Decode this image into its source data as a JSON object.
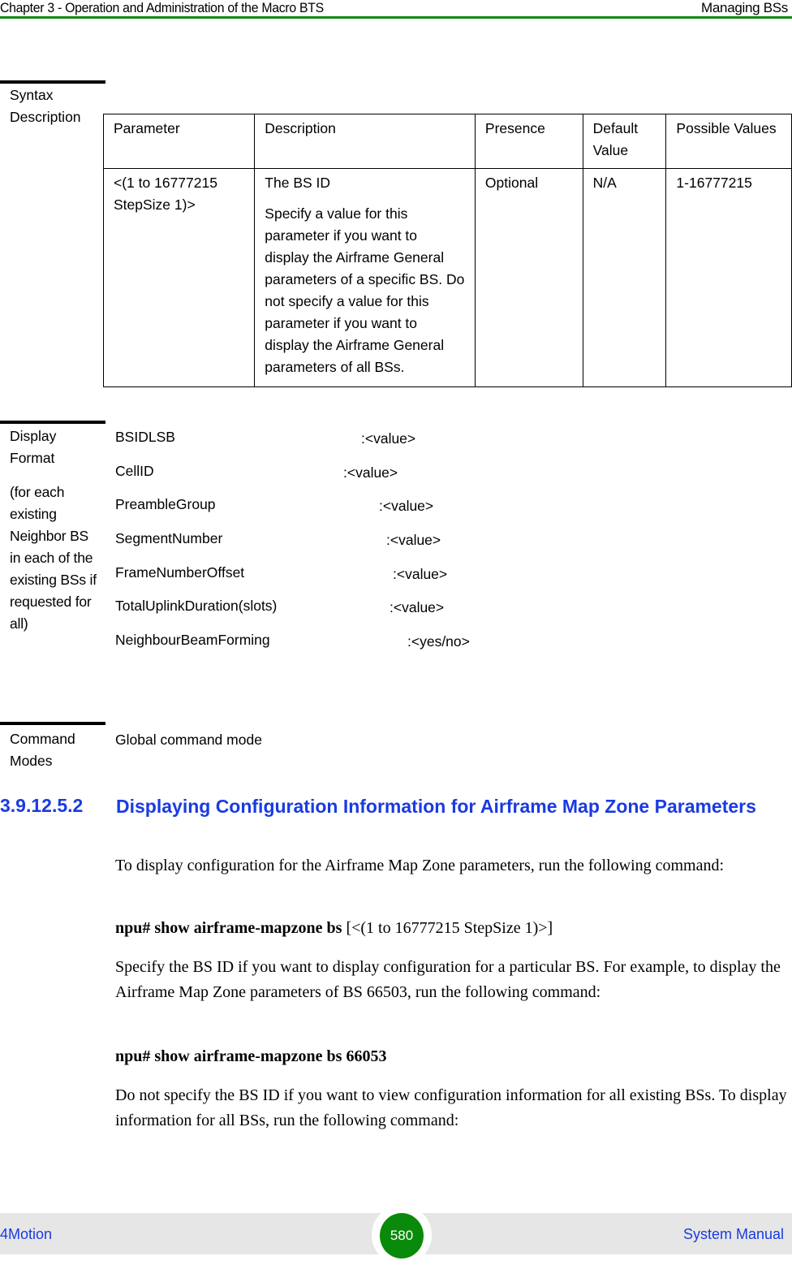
{
  "header": {
    "chapter_title": "Chapter 3 - Operation and Administration of the Macro BTS",
    "section_title": "Managing BSs"
  },
  "syntax_description": {
    "label_line1": "Syntax",
    "label_line2": "Description",
    "columns": [
      "Parameter",
      "Description",
      "Presence",
      "Default Value",
      "Possible Values"
    ],
    "rows": [
      {
        "parameter": "<(1 to 16777215 StepSize 1)>",
        "description_title": "The BS ID",
        "description_body": "Specify a value for this parameter if you want to display the Airframe General parameters of a specific BS. Do not specify a value for this parameter if you want to display the Airframe General parameters of all BSs.",
        "presence": "Optional",
        "default_value": "N/A",
        "possible_values": "1-16777215"
      }
    ]
  },
  "display_format": {
    "label_line1": "Display",
    "label_line2": "Format",
    "note": "(for each existing Neighbor BS in each of the existing BSs if requested for all)",
    "fields": [
      {
        "name": "BSIDLSB",
        "value": ":<value>"
      },
      {
        "name": "CellID",
        "value": ":<value>"
      },
      {
        "name": "PreambleGroup",
        "value": ":<value>"
      },
      {
        "name": "SegmentNumber",
        "value": ":<value>"
      },
      {
        "name": "FrameNumberOffset",
        "value": ":<value>"
      },
      {
        "name": "TotalUplinkDuration(slots)",
        "value": ":<value>"
      },
      {
        "name": "NeighbourBeamForming",
        "value": ":<yes/no>"
      }
    ]
  },
  "command_modes": {
    "label_line1": "Command",
    "label_line2": "Modes",
    "value": "Global command mode"
  },
  "section": {
    "number": "3.9.12.5.2",
    "title": "Displaying Configuration Information for Airframe Map Zone Parameters",
    "intro": "To display configuration for the Airframe Map Zone parameters, run the following command:",
    "command1_bold": "npu# show airframe-mapzone bs",
    "command1_rest": " [<(1 to 16777215 StepSize 1)>]",
    "para2": "Specify the BS ID if you want to display configuration for a particular BS. For example, to display the Airframe Map Zone parameters of BS 66503, run the following command:",
    "command2": "npu# show airframe-mapzone bs 66053",
    "para3": "Do not specify the BS ID if you want to view configuration information for all existing BSs. To display information for all BSs, run the following command:"
  },
  "footer": {
    "product": "4Motion",
    "page_number": "580",
    "manual": "System Manual"
  },
  "colors": {
    "header_rule": "#118a11",
    "heading_blue": "#1a3be0",
    "page_badge": "#0a8a0a",
    "footer_bg": "#e6e6e6"
  }
}
